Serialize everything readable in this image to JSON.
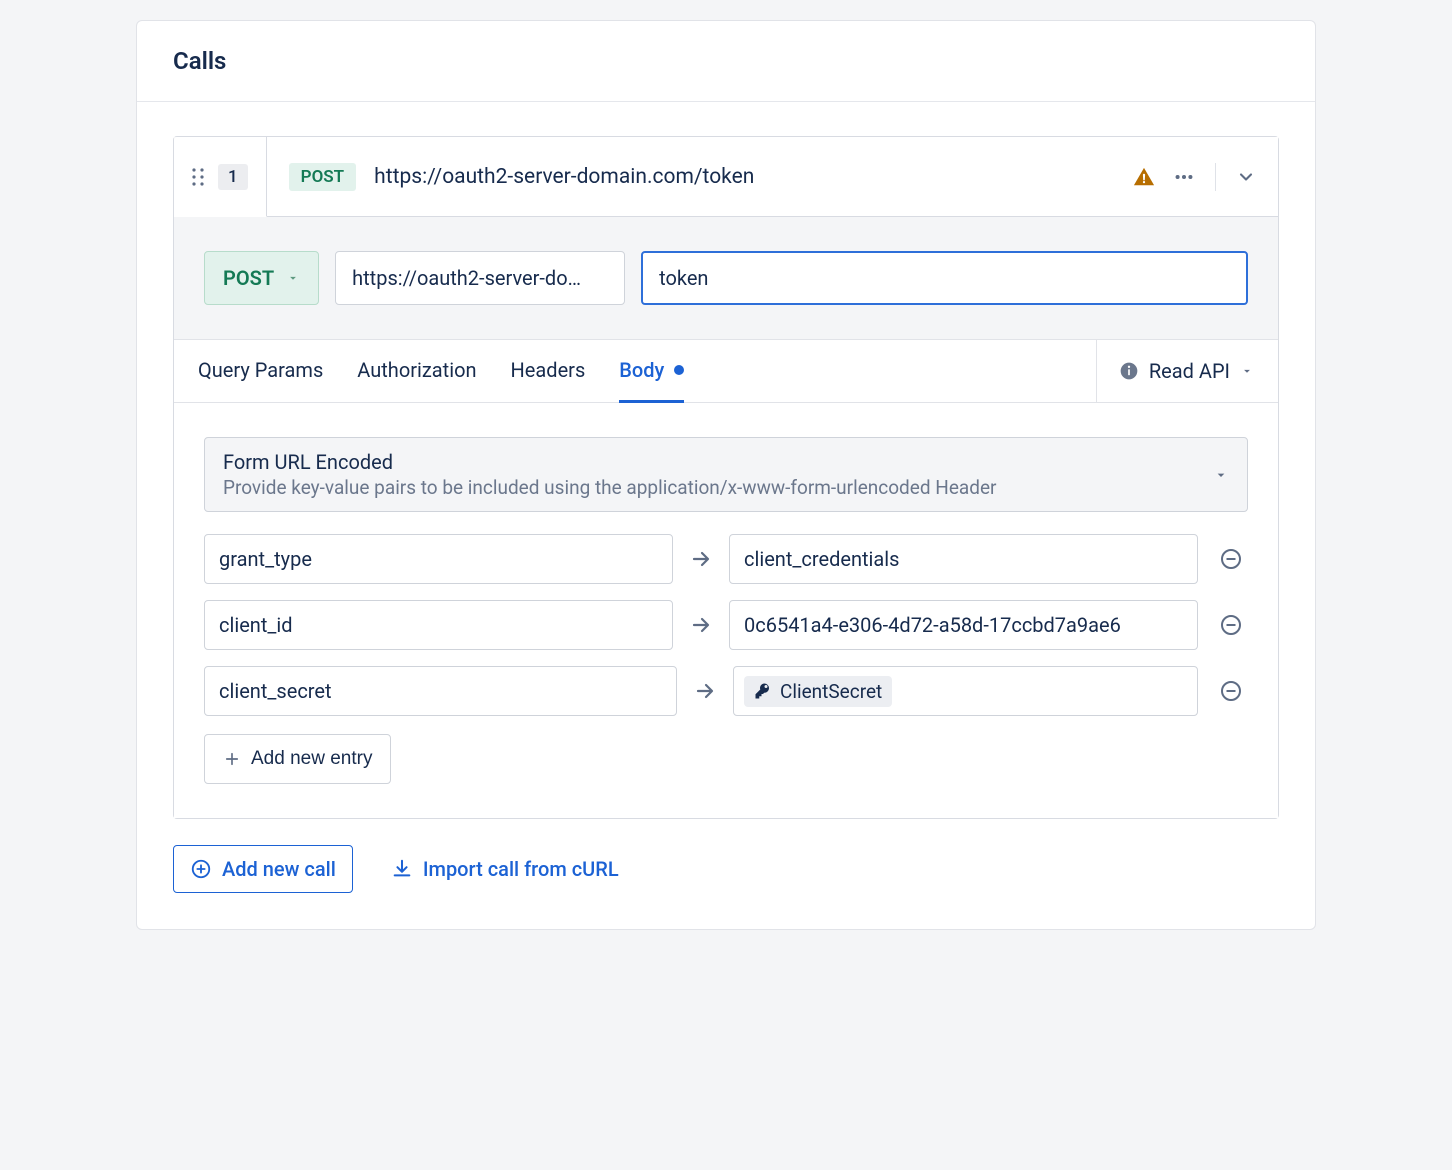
{
  "section_title": "Calls",
  "call": {
    "step_number": "1",
    "method": "POST",
    "full_url": "https://oauth2-server-domain.com/token",
    "base_url_display": "https://oauth2-server-do…",
    "path": "token"
  },
  "tabs": {
    "query_params": "Query Params",
    "authorization": "Authorization",
    "headers": "Headers",
    "body": "Body"
  },
  "read_api_label": "Read API",
  "body_encoding": {
    "title": "Form URL Encoded",
    "description": "Provide key-value pairs to be included using the application/x-www-form-urlencoded Header"
  },
  "kv_pairs": [
    {
      "key": "grant_type",
      "value": "client_credentials",
      "is_secret": false
    },
    {
      "key": "client_id",
      "value": "0c6541a4-e306-4d72-a58d-17ccbd7a9ae6",
      "is_secret": false
    },
    {
      "key": "client_secret",
      "value": "ClientSecret",
      "is_secret": true
    }
  ],
  "add_entry_label": "Add new entry",
  "add_call_label": "Add new call",
  "import_curl_label": "Import call from cURL"
}
